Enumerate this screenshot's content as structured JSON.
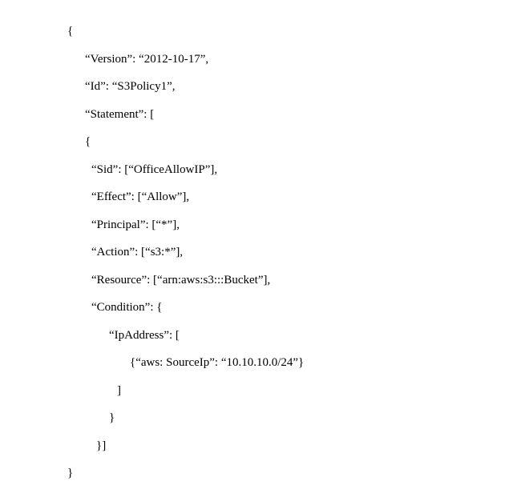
{
  "code": {
    "line1": "{",
    "line2": "“Version”: “2012-10-17”,",
    "line3": "“Id”: “S3Policy1”,",
    "line4": "“Statement”: [",
    "line5": "{",
    "line6": "“Sid”: [“OfficeAllowIP”],",
    "line7": "“Effect”: [“Allow”],",
    "line8": "“Principal”: [“*”],",
    "line9": "“Action”: [“s3:*”],",
    "line10": "“Resource”: [“arn:aws:s3:::Bucket”],",
    "line11": "“Condition”: {",
    "line12": "“IpAddress”: [",
    "line13": "{“aws: SourceIp”: “10.10.10.0/24”}",
    "line14": "]",
    "line15": "}",
    "line16": "}]",
    "line17": "}"
  }
}
